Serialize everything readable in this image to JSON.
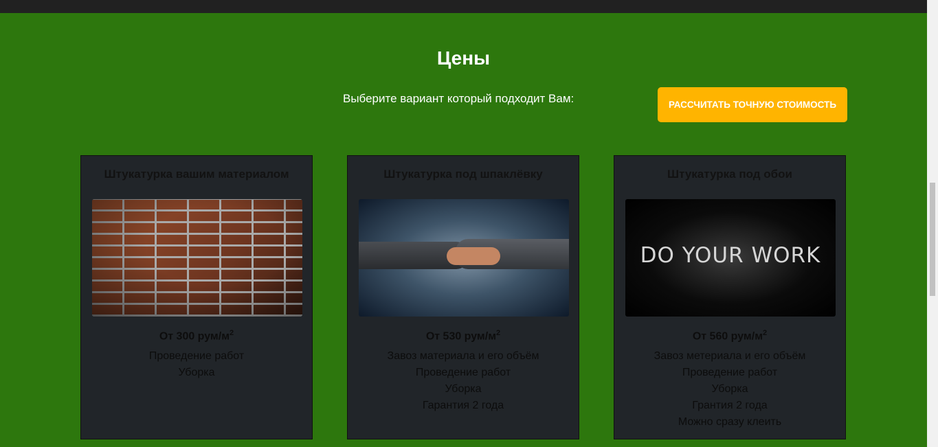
{
  "section": {
    "title": "Цены",
    "subtitle": "Выберите вариант который подходит Вам:",
    "cta_label": "Рассчитать точную стоимость"
  },
  "colors": {
    "background": "#2d770d",
    "topbar": "#212121",
    "card_bg": "#212529",
    "cta_bg": "#ffb400"
  },
  "cards": [
    {
      "title": "Штукатурка вашим материалом",
      "image": "brick-wall-image",
      "price": "От 300 рум/м",
      "price_sup": "2",
      "features": [
        "Проведение работ",
        "Уборка"
      ]
    },
    {
      "title": "Штукатурка под шпаклёвку",
      "image": "handshake-world-map-image",
      "price": "От 530 рум/м",
      "price_sup": "2",
      "features": [
        "Завоз материала и его объём",
        "Проведение работ",
        "Уборка",
        "Гарантия 2 года"
      ]
    },
    {
      "title": "Штукатурка под обои",
      "image": "do-your-work-image",
      "image_text": "DO YOUR WORK",
      "price": "От 560 рум/м",
      "price_sup": "2",
      "features": [
        "Завоз метериала и его объём",
        "Проведение работ",
        "Уборка",
        "Грантия 2 года",
        "Можно сразу клеить"
      ]
    }
  ]
}
